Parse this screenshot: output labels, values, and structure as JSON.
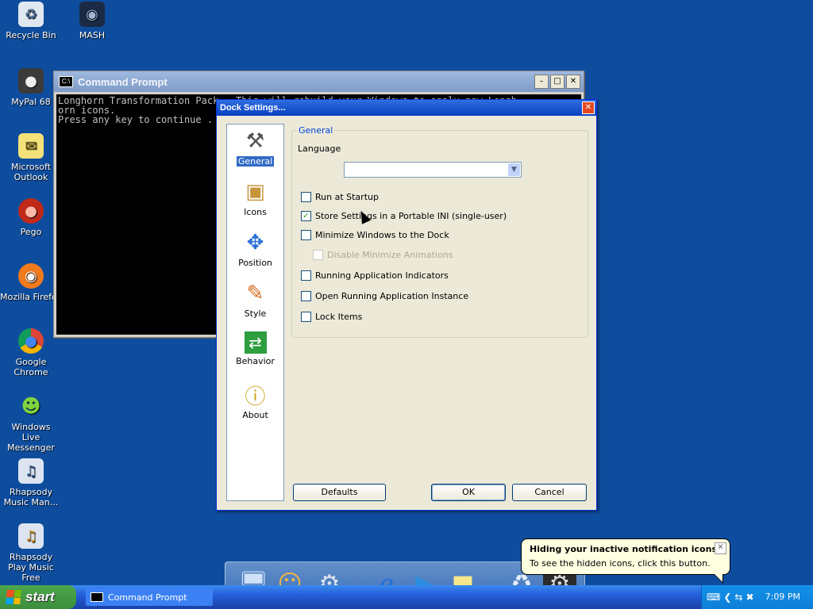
{
  "colors": {
    "desktop": "#0e4d9e",
    "titlebar_active": "#0a3fc2",
    "selection": "#316ac5",
    "group_title": "#0046d5"
  },
  "desktop_icons": [
    {
      "label": "Recycle Bin",
      "icon": "recycle-bin-icon"
    },
    {
      "label": "MASH",
      "icon": "mash-icon"
    },
    {
      "label": "MyPal 68",
      "icon": "mypal-icon"
    },
    {
      "label": "Microsoft Outlook",
      "icon": "outlook-icon"
    },
    {
      "label": "Pego",
      "icon": "pego-icon"
    },
    {
      "label": "Mozilla Firefox",
      "icon": "firefox-icon"
    },
    {
      "label": "Google Chrome",
      "icon": "chrome-icon"
    },
    {
      "label": "Windows Live Messenger",
      "icon": "messenger-icon"
    },
    {
      "label": "Rhapsody Music Man...",
      "icon": "rhapsody-icon"
    },
    {
      "label": "Rhapsody Play Music Free",
      "icon": "rhapsody-play-icon"
    }
  ],
  "cmd_window": {
    "title": "Command Prompt",
    "console_lines": [
      "Longhorn Transformation Pack - This will rebuild your Windows to apply new Longh",
      "orn icons.",
      "Press any key to continue . . ."
    ]
  },
  "dialog": {
    "title": "Dock Settings...",
    "nav": [
      {
        "label": "General",
        "icon": "tools-icon",
        "selected": true
      },
      {
        "label": "Icons",
        "icon": "box-icon",
        "selected": false
      },
      {
        "label": "Position",
        "icon": "move-arrows-icon",
        "selected": false
      },
      {
        "label": "Style",
        "icon": "paintbrush-icon",
        "selected": false
      },
      {
        "label": "Behavior",
        "icon": "behavior-arrows-icon",
        "selected": false
      },
      {
        "label": "About",
        "icon": "info-icon",
        "selected": false
      }
    ],
    "group_title": "General",
    "language_label": "Language",
    "language_value": "",
    "checkboxes": [
      {
        "label": "Run at Startup",
        "checked": false,
        "disabled": false
      },
      {
        "label": "Store Settings in a Portable INI (single-user)",
        "checked": true,
        "disabled": false
      },
      {
        "label": "Minimize Windows to the Dock",
        "checked": false,
        "disabled": false
      },
      {
        "label": "Disable Minimize Animations",
        "checked": false,
        "disabled": true
      },
      {
        "label": "Running Application Indicators",
        "checked": false,
        "disabled": false
      },
      {
        "label": "Open Running Application Instance",
        "checked": false,
        "disabled": false
      },
      {
        "label": "Lock Items",
        "checked": false,
        "disabled": false
      }
    ],
    "buttons": {
      "defaults": "Defaults",
      "ok": "OK",
      "cancel": "Cancel"
    }
  },
  "taskbar": {
    "start_label": "start",
    "tasks": [
      {
        "label": "Command Prompt"
      }
    ],
    "clock": "7:09 PM"
  },
  "balloon": {
    "title": "Hiding your inactive notification icons...",
    "text": "To see the hidden icons, click this button."
  },
  "dock_items": [
    {
      "icon": "computer-icon"
    },
    {
      "icon": "users-icon"
    },
    {
      "icon": "control-panel-icon"
    },
    {
      "icon": "internet-explorer-icon"
    },
    {
      "icon": "media-player-icon"
    },
    {
      "icon": "notes-icon"
    },
    {
      "icon": "recycle-bin-icon"
    },
    {
      "icon": "settings-icon"
    }
  ]
}
